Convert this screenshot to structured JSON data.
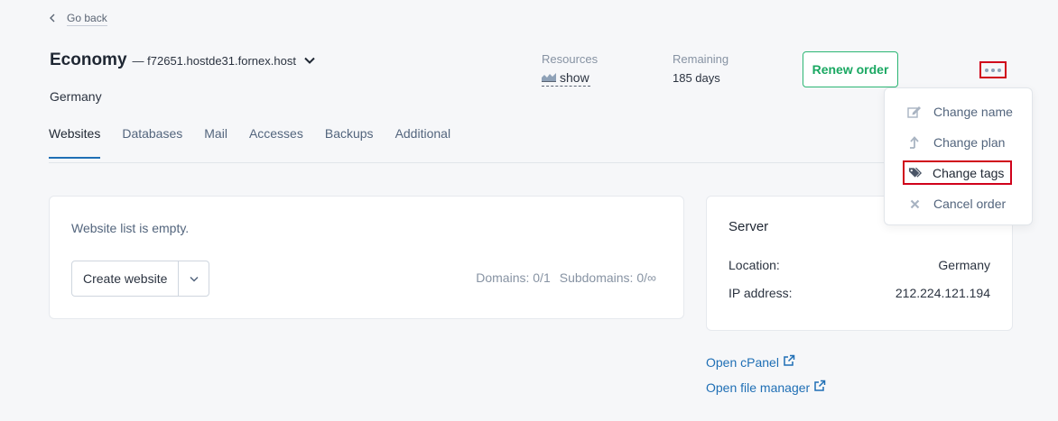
{
  "nav": {
    "back_label": "Go back"
  },
  "header": {
    "plan": "Economy",
    "host": "— f72651.hostde31.fornex.host",
    "country": "Germany"
  },
  "stats": {
    "resources_label": "Resources",
    "resources_action": "show",
    "remaining_label": "Remaining",
    "remaining_value": "185 days"
  },
  "actions": {
    "renew_label": "Renew order"
  },
  "menu": {
    "items": [
      {
        "label": "Change name",
        "icon": "edit-icon"
      },
      {
        "label": "Change plan",
        "icon": "arrow-up-icon"
      },
      {
        "label": "Change tags",
        "icon": "tags-icon"
      },
      {
        "label": "Cancel order",
        "icon": "close-icon"
      }
    ]
  },
  "tabs": [
    {
      "label": "Websites",
      "active": true
    },
    {
      "label": "Databases"
    },
    {
      "label": "Mail"
    },
    {
      "label": "Accesses"
    },
    {
      "label": "Backups"
    },
    {
      "label": "Additional"
    }
  ],
  "websites": {
    "empty_text": "Website list is empty.",
    "create_label": "Create website",
    "domains": "Domains: 0/1",
    "subdomains": "Subdomains: 0/∞"
  },
  "server": {
    "title": "Server",
    "rows": [
      {
        "label": "Location:",
        "value": "Germany"
      },
      {
        "label": "IP address:",
        "value": "212.224.121.194"
      }
    ]
  },
  "links": {
    "cpanel": "Open cPanel",
    "file_manager": "Open file manager"
  },
  "colors": {
    "accent_green": "#1aa862",
    "link_blue": "#1f6fb5",
    "highlight_red": "#d0021b"
  }
}
